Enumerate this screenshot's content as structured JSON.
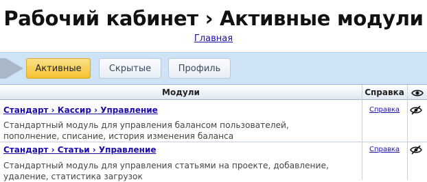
{
  "header": {
    "title": "Рабочий кабинет › Активные модули",
    "home_link": "Главная"
  },
  "tabs": [
    {
      "label": "Активные",
      "active": true
    },
    {
      "label": "Скрытые",
      "active": false
    },
    {
      "label": "Профиль",
      "active": false
    }
  ],
  "table": {
    "columns": {
      "modules": "Модули",
      "help": "Справка",
      "visibility_icon": "eye-icon"
    },
    "rows": [
      {
        "title": "Стандарт › Кассир › Управление",
        "description_line1": "Стандартный модуль для управления балансом пользователей,",
        "description_line2": "пополнение, списание, история изменения баланса",
        "help": "Справка",
        "visibility_icon": "eye-slash-icon"
      },
      {
        "title": "Стандарт › Статьи › Управление",
        "description_line1": "Стандартный модуль для управления статьями на проекте, добавление,",
        "description_line2": "удаление, статистика загрузок",
        "help": "Справка",
        "visibility_icon": "eye-slash-icon"
      }
    ]
  },
  "colors": {
    "tabbar_bg": "#cfe3f7",
    "active_tab": "#f2c230",
    "link": "#1a0dab"
  }
}
